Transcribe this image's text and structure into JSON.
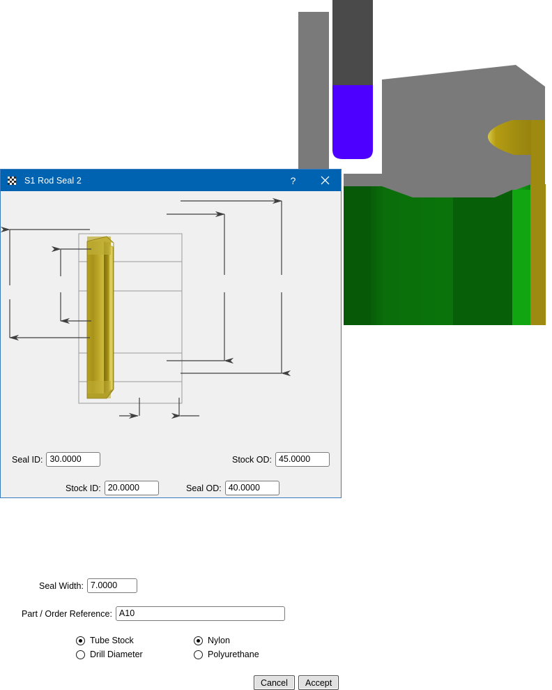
{
  "window": {
    "title": "S1 Rod Seal 2",
    "icon": "seal-part-icon",
    "help_label": "?",
    "close_label": "✕",
    "titlebar_color": "#0063b1",
    "border_color": "#3a7bbf",
    "body_color": "#f0f0f0"
  },
  "fields": {
    "seal_id": {
      "label": "Seal ID:",
      "value": "30.0000"
    },
    "stock_id": {
      "label": "Stock ID:",
      "value": "20.0000"
    },
    "seal_od": {
      "label": "Seal OD:",
      "value": "40.0000"
    },
    "stock_od": {
      "label": "Stock OD:",
      "value": "45.0000"
    },
    "seal_width": {
      "label": "Seal Width:",
      "value": "7.0000"
    },
    "part_ref": {
      "label": "Part / Order Reference:",
      "value": "A10",
      "placeholder": ""
    }
  },
  "stock_type": {
    "options": [
      {
        "label": "Tube Stock",
        "selected": true
      },
      {
        "label": "Drill Diameter",
        "selected": false
      }
    ]
  },
  "material": {
    "options": [
      {
        "label": "Nylon",
        "selected": true
      },
      {
        "label": "Polyurethane",
        "selected": false
      }
    ]
  },
  "buttons": {
    "cancel": "Cancel",
    "accept": "Accept"
  },
  "diagram": {
    "seal_color_light": "#c9b93f",
    "seal_color_mid": "#b7a01e",
    "seal_color_dark": "#8f7d12",
    "dimension_line_color": "#3f3f3f",
    "outline_color": "#9a9a9a"
  },
  "viewport": {
    "background": "#ffffff",
    "housing_color": "#7a7a7a",
    "rod_dark_color": "#4a4a4a",
    "piston_color": "#4d00ff",
    "bore_color": "#0a6e0a",
    "bore_highlight_color": "#14b414",
    "seal_color": "#9e8a10"
  }
}
